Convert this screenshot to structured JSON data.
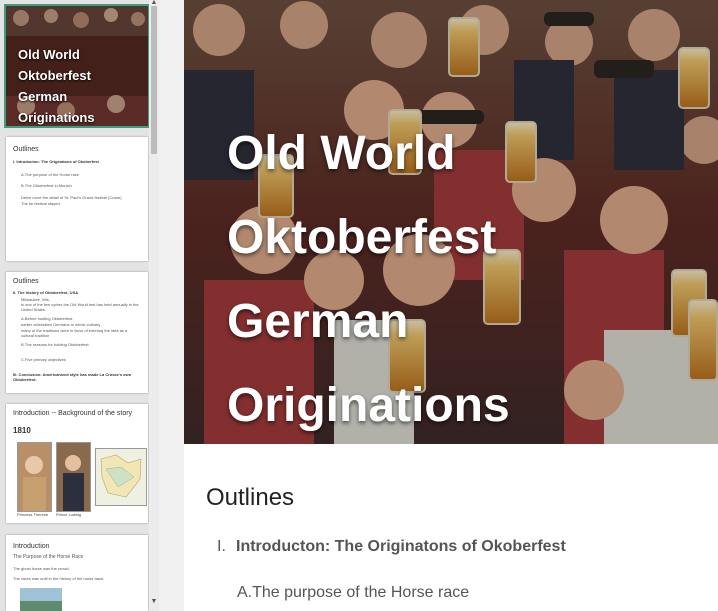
{
  "main_slide": {
    "title_lines": [
      "Old World",
      "Oktoberfest German",
      "Originations"
    ],
    "outlines_heading": "Outlines",
    "items": [
      {
        "num": "I.",
        "text": "Introducton: The Originatons of Okoberfest"
      }
    ],
    "subitems": [
      {
        "text": "A.The purpose of the Horse race"
      }
    ]
  },
  "thumbnails": [
    {
      "title_lines": [
        "Old World",
        "Oktoberfest German",
        "Originations"
      ]
    },
    {
      "heading": "Outlines",
      "line1": "I.   Introducton: The Originatons of Okoberfest",
      "line2": "A.The purpose of the Horse race",
      "line3": "B.The Oktoberfest in Munich",
      "line4": "Delve more the detail of St. Paul's Grand festival (Crane)",
      "line5": "The tie festival stayed"
    },
    {
      "heading": "Outlines",
      "line1": "II.  The history of Oktoberfest, USA",
      "line2": "Milwaukee, Wis.",
      "line3": "is one of the few cycles the Old World fest has held annually in the United States",
      "line4": "A.Before holding Oktoberfest",
      "line5": "earlier celebrated Germans to mimic culinary",
      "line6": "many of the traditions were in favor of entering the idea as a cultural tradition",
      "line7": "B.The reasons for holding Oktoberfest",
      "line8": "C.Five primary objectives",
      "line9": "III. Conclusion: Americanized style has made La Crosse's own Oktoberfest."
    },
    {
      "heading": "Introduction -- Background of the story",
      "year": "1810",
      "caption1": "Princess Therese",
      "caption2": "Prince Ludwig"
    },
    {
      "heading": "Introduction",
      "line1": "The Purpose of the Horse Race",
      "line2": "The ghost horse was the crowd.",
      "line3": "The races was until in the history of the horse track."
    }
  ],
  "colors": {
    "selected_outline": "#3c9e7d",
    "title_text": "#ffffff"
  }
}
